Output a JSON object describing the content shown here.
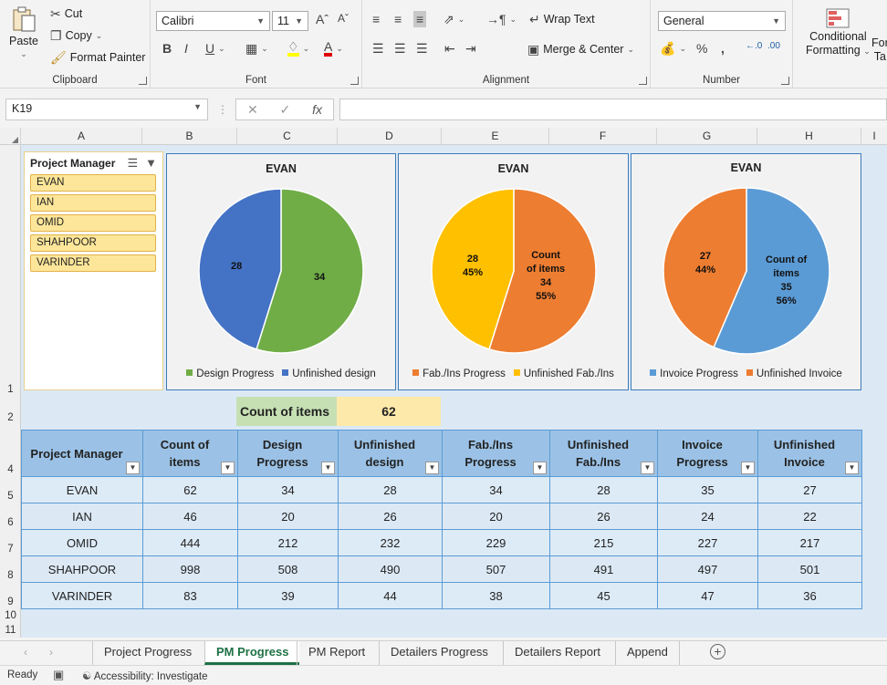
{
  "ribbon": {
    "clipboard": {
      "label": "Clipboard",
      "paste": "Paste",
      "cut": "Cut",
      "copy": "Copy",
      "format_painter": "Format Painter"
    },
    "font": {
      "label": "Font",
      "name": "Calibri",
      "size": "11"
    },
    "alignment": {
      "label": "Alignment",
      "wrap_text": "Wrap Text",
      "merge_center": "Merge & Center"
    },
    "number": {
      "label": "Number",
      "format": "General"
    },
    "styles": {
      "conditional_formatting": "Conditional",
      "conditional_formatting_2": "Formatting",
      "format_as_table": "For",
      "format_as_table_2": "Ta"
    }
  },
  "formula_bar": {
    "name_box": "K19",
    "formula": ""
  },
  "columns": [
    "A",
    "B",
    "C",
    "D",
    "E",
    "F",
    "G",
    "H",
    "I"
  ],
  "rows": [
    "1",
    "2",
    "4",
    "5",
    "6",
    "7",
    "8",
    "9",
    "10",
    "11"
  ],
  "slicer": {
    "title": "Project Manager",
    "items": [
      "EVAN",
      "IAN",
      "OMID",
      "SHAHPOOR",
      "VARINDER"
    ]
  },
  "charts": [
    {
      "title": "EVAN",
      "type": "pie",
      "slices": [
        {
          "name": "Design Progress",
          "value": 34,
          "color": "#70ad47",
          "label": "34"
        },
        {
          "name": "Unfinished design",
          "value": 28,
          "color": "#4472c4",
          "label": "28"
        }
      ]
    },
    {
      "title": "EVAN",
      "type": "pie",
      "slices": [
        {
          "name": "Fab./Ins Progress",
          "value": 34,
          "color": "#ed7d31",
          "label_lines": [
            "Count",
            "of items",
            "34",
            "55%"
          ]
        },
        {
          "name": "Unfinished Fab./Ins",
          "value": 28,
          "color": "#ffc000",
          "label_lines": [
            "28",
            "45%"
          ]
        }
      ]
    },
    {
      "title": "EVAN",
      "type": "pie",
      "slices": [
        {
          "name": "Invoice Progress",
          "value": 35,
          "color": "#5b9bd5",
          "label_lines": [
            "Count of",
            "items",
            "35",
            "56%"
          ]
        },
        {
          "name": "Unfinished Invoice",
          "value": 27,
          "color": "#ed7d31",
          "label_lines": [
            "27",
            "44%"
          ]
        }
      ]
    }
  ],
  "count_of_items": {
    "label": "Count of items",
    "value": "62"
  },
  "table": {
    "headers": [
      "Project Manager",
      "Count of items",
      "Design Progress",
      "Unfinished design",
      "Fab./Ins Progress",
      "Unfinished Fab./Ins",
      "Invoice Progress",
      "Unfinished Invoice"
    ],
    "rows": [
      [
        "EVAN",
        "62",
        "34",
        "28",
        "34",
        "28",
        "35",
        "27"
      ],
      [
        "IAN",
        "46",
        "20",
        "26",
        "20",
        "26",
        "24",
        "22"
      ],
      [
        "OMID",
        "444",
        "212",
        "232",
        "229",
        "215",
        "227",
        "217"
      ],
      [
        "SHAHPOOR",
        "998",
        "508",
        "490",
        "507",
        "491",
        "497",
        "501"
      ],
      [
        "VARINDER",
        "83",
        "39",
        "44",
        "38",
        "45",
        "47",
        "36"
      ]
    ]
  },
  "sheet_tabs": [
    "Project Progress",
    "PM Progress",
    "PM Report",
    "Detailers Progress",
    "Detailers Report",
    "Append"
  ],
  "active_tab": "PM Progress",
  "status": {
    "ready": "Ready",
    "accessibility": "Accessibility: Investigate"
  }
}
